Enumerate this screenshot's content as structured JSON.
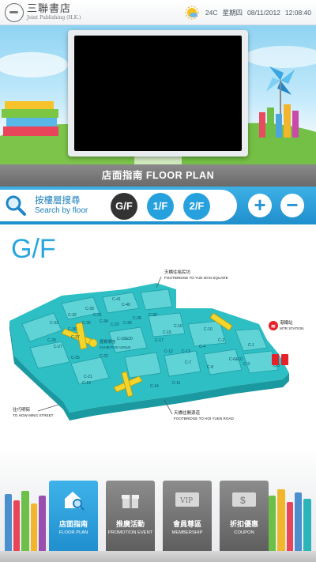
{
  "header": {
    "logo_cn": "三聯書店",
    "logo_en": "Joint Publishing (H.K.)",
    "temperature": "24C",
    "weekday": "星期四",
    "date": "08/11/2012",
    "time": "12:08:40"
  },
  "title_bar": {
    "label": "店面指南 FLOOR PLAN"
  },
  "search": {
    "label_cn": "按樓層搜尋",
    "label_en": "Search by floor",
    "floors": [
      "G/F",
      "1/F",
      "2/F"
    ],
    "active_floor": "G/F",
    "zoom_in": "+",
    "zoom_out": "−"
  },
  "floor_title": "G/F",
  "map": {
    "footbridge_north_cn": "天橋往裕民坊",
    "footbridge_north_en": "FOOTBRIDGE TO YUE MAN SQUARE",
    "footbridge_south_cn": "天橋往開源道",
    "footbridge_south_en": "FOOTBRIDGE TO HOI YUEN ROAD",
    "mtr_cn": "港鐵站",
    "mtr_en": "MTR STATION",
    "street_cn": "往巧明街",
    "street_en": "TO HOW MING STREET",
    "venue_cn": "展覽場地",
    "venue_en": "EXHIBITION VENUE",
    "units": [
      "C-41",
      "C-40",
      "C-28",
      "C-39",
      "C-32",
      "C-31",
      "C-33",
      "C-30",
      "C-16",
      "C-35",
      "C-34",
      "C-26",
      "C-22",
      "C-15",
      "C-36",
      "C-37",
      "C-29",
      "C-27",
      "C-25",
      "C-17",
      "C-21",
      "C-23",
      "C-18&20",
      "C-19",
      "C-12",
      "C-13",
      "C-10",
      "C-2",
      "C-4",
      "C-7",
      "C-6&10",
      "C-8",
      "C-9",
      "C-11",
      "C-14",
      "C-1",
      "C-3"
    ]
  },
  "menu": [
    {
      "cn": "店面指南",
      "en": "FLOOR PLAN",
      "icon": "house-search-icon"
    },
    {
      "cn": "推廣活動",
      "en": "PROMOTION EVENT",
      "icon": "gift-icon"
    },
    {
      "cn": "會員尊區",
      "en": "MEMBERSHIP",
      "icon": "vip-card-icon"
    },
    {
      "cn": "折扣優惠",
      "en": "COUPON",
      "icon": "coupon-icon"
    }
  ],
  "colors": {
    "brand_blue": "#29a6df",
    "map_teal": "#2bbfc4",
    "escalator_yellow": "#f3d52b",
    "active_floor": "#333333"
  }
}
